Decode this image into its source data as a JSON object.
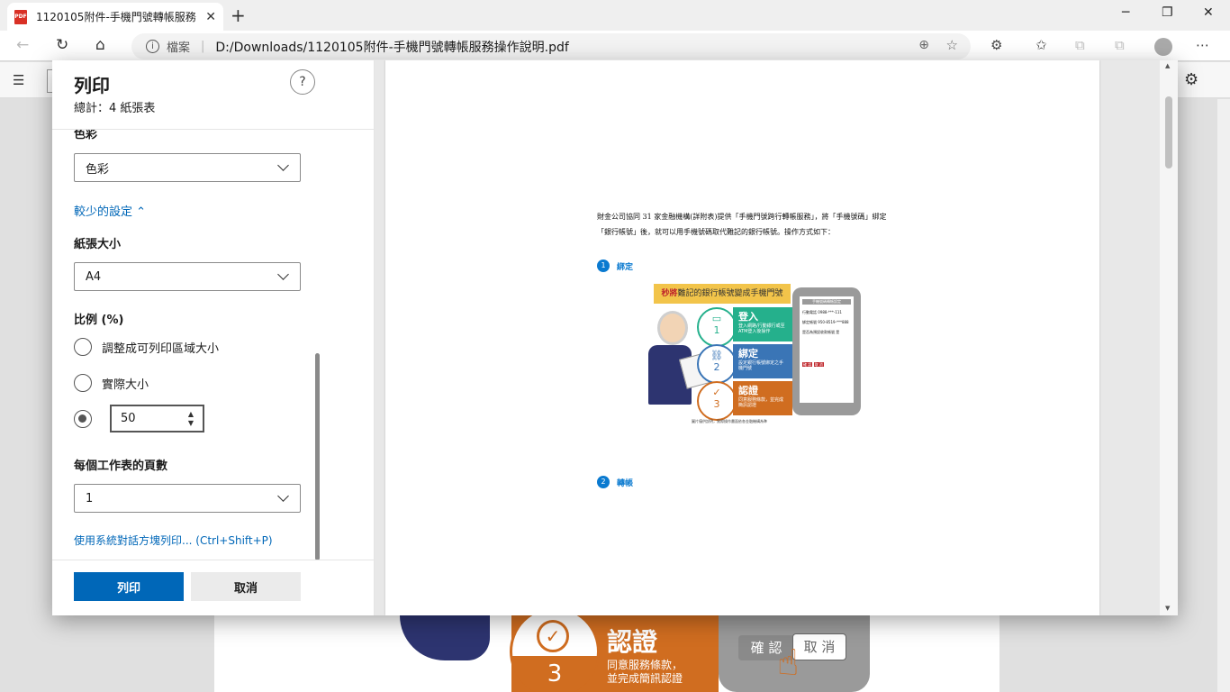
{
  "browser": {
    "tab_title": "1120105附件-手機門號轉帳服務",
    "tab_pdf_badge": "PDF",
    "tab_close": "✕",
    "new_tab": "+",
    "win_min": "─",
    "win_max": "❐",
    "win_close": "✕",
    "back": "←",
    "refresh": "↻",
    "home": "⌂",
    "info_glyph": "i",
    "file_label": "檔案",
    "separator": "|",
    "url": "D:/Downloads/1120105附件-手機門號轉帳服務操作說明.pdf",
    "zoom_icon": "⊕",
    "fav_icon": "☆",
    "ext_icon": "⚙",
    "favorites_icon": "✩",
    "collections_icon": "⧉",
    "more_icon": "⋯"
  },
  "pdf_toolbar": {
    "list_icon": "☰",
    "settings_icon": "⚙"
  },
  "print_panel": {
    "title": "列印",
    "subtitle": "總計：4 紙張表",
    "help": "?",
    "color_label": "色彩",
    "color_value": "色彩",
    "fewer_settings": "較少的設定 ⌃",
    "paper_size_label": "紙張大小",
    "paper_size_value": "A4",
    "scale_label": "比例 (%)",
    "scale_options": [
      "調整成可列印區域大小",
      "實際大小"
    ],
    "scale_value": "50",
    "pages_per_sheet_label": "每個工作表的頁數",
    "pages_per_sheet_value": "1",
    "system_dialog_link": "使用系統對話方塊列印... (Ctrl+Shift+P)",
    "print_button": "列印",
    "cancel_button": "取消"
  },
  "preview": {
    "intro_text": "財金公司協同 31 家金融機構(詳附表)提供「手機門號跨行轉帳服務」，將「手機號碼」綁定「銀行帳號」後，就可以用手機號碼取代難記的銀行帳號。操作方式如下：",
    "step1_num": "1",
    "step1_title": "綁定",
    "step2_num": "2",
    "step2_title": "轉帳",
    "banner_bold": "秒將",
    "banner_rest": "難記的銀行帳號變成手機門號",
    "rows": [
      {
        "num": "1",
        "title": "登入",
        "desc": "登入網路/行動銀行或至ATM登入後操作",
        "icon": "▭"
      },
      {
        "num": "2",
        "title": "綁定",
        "desc": "設定銀行帳號綁定之手機門號",
        "icon": "⛓"
      },
      {
        "num": "3",
        "title": "認證",
        "desc": "同意服務條款，並完成簡訊認證",
        "icon": "✓"
      }
    ],
    "phone_header": "手機號碼轉帳設定",
    "phone_rows": [
      "行動電話 0988-***-111",
      "綁定帳號 950-8519-***888",
      "是否為預設收款帳號 是"
    ],
    "phone_confirm": "確 認",
    "phone_cancel": "取 消",
    "caption": "圖片僅供說明，實際操作畫面依各金融機構為準"
  },
  "background_page": {
    "title": "認證",
    "subtitle_1": "同意服務條款，",
    "subtitle_2": "並完成簡訊認證",
    "num": "3",
    "check": "✓",
    "btn_confirm": "確 認",
    "btn_cancel": "取 消",
    "hand_icon": "☝"
  }
}
